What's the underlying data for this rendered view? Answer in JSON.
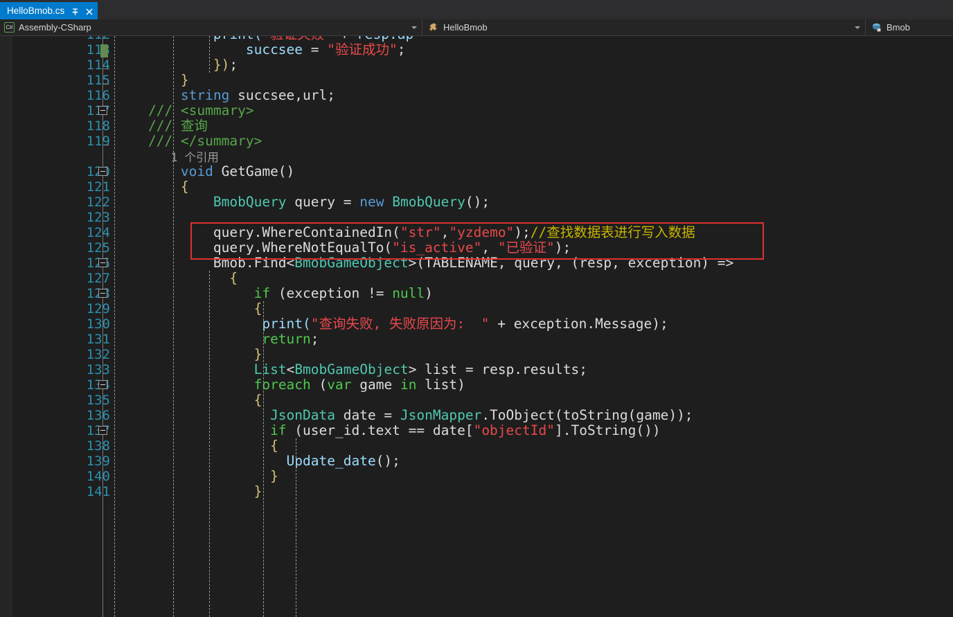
{
  "window": {
    "app": "Visual Studio",
    "theme_bg": "#1e1e1e",
    "accent": "#007acc"
  },
  "tabstrip": {
    "tabs": [
      {
        "title": "HelloBmob.cs",
        "active": true,
        "pin_icon": "pin-icon",
        "close_icon": "close-icon"
      }
    ]
  },
  "navbar": {
    "project": {
      "icon": "csharp-project-icon",
      "icon_text": "C#",
      "label": "Assembly-CSharp",
      "dropdown_icon": "chevron-down-icon"
    },
    "member": {
      "icon": "method-icon",
      "label": "HelloBmob",
      "dropdown_icon": "chevron-down-icon"
    },
    "type": {
      "icon": "class-private-icon",
      "label": "Bmob"
    }
  },
  "editor": {
    "language": "csharp",
    "first_visible_line": 112,
    "last_visible_line": 141,
    "gutter": {
      "line_numbers": [
        113,
        114,
        115,
        116,
        117,
        118,
        119,
        120,
        121,
        122,
        123,
        124,
        125,
        126,
        127,
        128,
        129,
        130,
        131,
        132,
        133,
        134,
        135,
        136,
        137,
        138,
        139,
        140,
        141
      ],
      "change_bar_color": "#608b4e",
      "line_number_color": "#2b91af",
      "collapse_icon": "collapse-minus-icon"
    },
    "annotation": {
      "shape": "rectangle",
      "color": "#e03030",
      "covers_lines": [
        124,
        125
      ]
    },
    "lines": [
      {
        "n": 112,
        "clipped": true,
        "segments": [
          {
            "t": "            ",
            "c": "plain"
          },
          {
            "t": "print(",
            "c": "ident"
          },
          {
            "t": "\"验证失败\"",
            "c": "str"
          },
          {
            "t": " + ",
            "c": "plain"
          },
          {
            "t": "resp.ap",
            "c": "ident"
          }
        ]
      },
      {
        "n": 113,
        "segments": [
          {
            "t": "                ",
            "c": "plain"
          },
          {
            "t": "succsee",
            "c": "ident"
          },
          {
            "t": " = ",
            "c": "plain"
          },
          {
            "t": "\"验证成功\"",
            "c": "str"
          },
          {
            "t": ";",
            "c": "plain"
          }
        ]
      },
      {
        "n": 114,
        "segments": [
          {
            "t": "            ",
            "c": "plain"
          },
          {
            "t": "})",
            "c": "brace"
          },
          {
            "t": ";",
            "c": "plain"
          }
        ]
      },
      {
        "n": 115,
        "segments": [
          {
            "t": "        ",
            "c": "plain"
          },
          {
            "t": "}",
            "c": "brace"
          }
        ]
      },
      {
        "n": 116,
        "segments": [
          {
            "t": "        ",
            "c": "plain"
          },
          {
            "t": "string",
            "c": "kw"
          },
          {
            "t": " succsee,url;",
            "c": "plain"
          }
        ]
      },
      {
        "n": 117,
        "segments": [
          {
            "t": "    ",
            "c": "plain"
          },
          {
            "t": "/// <summary>",
            "c": "cmt"
          }
        ]
      },
      {
        "n": 118,
        "segments": [
          {
            "t": "    ",
            "c": "plain"
          },
          {
            "t": "/// 查询",
            "c": "cmt"
          }
        ]
      },
      {
        "n": 119,
        "segments": [
          {
            "t": "    ",
            "c": "plain"
          },
          {
            "t": "/// </summary>",
            "c": "cmt"
          }
        ]
      },
      {
        "n": null,
        "codelens": true,
        "segments": [
          {
            "t": "        ",
            "c": "plain"
          },
          {
            "t": "1 个引用",
            "c": "codelens"
          }
        ]
      },
      {
        "n": 120,
        "segments": [
          {
            "t": "        ",
            "c": "plain"
          },
          {
            "t": "void",
            "c": "kw"
          },
          {
            "t": " GetGame()",
            "c": "plain"
          }
        ]
      },
      {
        "n": 121,
        "segments": [
          {
            "t": "        ",
            "c": "plain"
          },
          {
            "t": "{",
            "c": "brace"
          }
        ]
      },
      {
        "n": 122,
        "segments": [
          {
            "t": "            ",
            "c": "plain"
          },
          {
            "t": "BmobQuery",
            "c": "type"
          },
          {
            "t": " query = ",
            "c": "plain"
          },
          {
            "t": "new",
            "c": "kw"
          },
          {
            "t": " ",
            "c": "plain"
          },
          {
            "t": "BmobQuery",
            "c": "type"
          },
          {
            "t": "();",
            "c": "plain"
          }
        ]
      },
      {
        "n": 123,
        "segments": []
      },
      {
        "n": 124,
        "segments": [
          {
            "t": "            ",
            "c": "plain"
          },
          {
            "t": "query.WhereContainedIn(",
            "c": "plain"
          },
          {
            "t": "\"str\"",
            "c": "str"
          },
          {
            "t": ",",
            "c": "plain"
          },
          {
            "t": "\"yzdemo\"",
            "c": "str"
          },
          {
            "t": ");",
            "c": "plain"
          },
          {
            "t": "//查找数据表进行写入数据",
            "c": "cmtyel"
          }
        ]
      },
      {
        "n": 125,
        "segments": [
          {
            "t": "            ",
            "c": "plain"
          },
          {
            "t": "query.WhereNotEqualTo(",
            "c": "plain"
          },
          {
            "t": "\"is_active\"",
            "c": "str"
          },
          {
            "t": ", ",
            "c": "plain"
          },
          {
            "t": "\"已验证\"",
            "c": "str"
          },
          {
            "t": ");",
            "c": "plain"
          }
        ]
      },
      {
        "n": 126,
        "segments": [
          {
            "t": "            ",
            "c": "plain"
          },
          {
            "t": "Bmob.Find<",
            "c": "plain"
          },
          {
            "t": "BmobGameObject",
            "c": "type"
          },
          {
            "t": ">(TABLENAME, query, (resp, exception) =>",
            "c": "plain"
          }
        ]
      },
      {
        "n": 127,
        "segments": [
          {
            "t": "              ",
            "c": "plain"
          },
          {
            "t": "{",
            "c": "brace"
          }
        ]
      },
      {
        "n": 128,
        "segments": [
          {
            "t": "                 ",
            "c": "plain"
          },
          {
            "t": "if",
            "c": "kwctl"
          },
          {
            "t": " (exception != ",
            "c": "plain"
          },
          {
            "t": "null",
            "c": "kwctl"
          },
          {
            "t": ")",
            "c": "plain"
          }
        ]
      },
      {
        "n": 129,
        "segments": [
          {
            "t": "                 ",
            "c": "plain"
          },
          {
            "t": "{",
            "c": "brace"
          }
        ]
      },
      {
        "n": 130,
        "segments": [
          {
            "t": "                  ",
            "c": "plain"
          },
          {
            "t": "print(",
            "c": "ident"
          },
          {
            "t": "\"查询失败, 失败原因为:  \"",
            "c": "str"
          },
          {
            "t": " + exception.Message);",
            "c": "plain"
          }
        ]
      },
      {
        "n": 131,
        "segments": [
          {
            "t": "                  ",
            "c": "plain"
          },
          {
            "t": "return",
            "c": "kwctl"
          },
          {
            "t": ";",
            "c": "plain"
          }
        ]
      },
      {
        "n": 132,
        "segments": [
          {
            "t": "                 ",
            "c": "plain"
          },
          {
            "t": "}",
            "c": "brace"
          }
        ]
      },
      {
        "n": 133,
        "segments": [
          {
            "t": "                 ",
            "c": "plain"
          },
          {
            "t": "List",
            "c": "type"
          },
          {
            "t": "<",
            "c": "plain"
          },
          {
            "t": "BmobGameObject",
            "c": "type"
          },
          {
            "t": "> list = resp.results;",
            "c": "plain"
          }
        ]
      },
      {
        "n": 134,
        "segments": [
          {
            "t": "                 ",
            "c": "plain"
          },
          {
            "t": "foreach",
            "c": "kwctl"
          },
          {
            "t": " (",
            "c": "plain"
          },
          {
            "t": "var",
            "c": "kwctl"
          },
          {
            "t": " game ",
            "c": "plain"
          },
          {
            "t": "in",
            "c": "kwctl"
          },
          {
            "t": " list)",
            "c": "plain"
          }
        ]
      },
      {
        "n": 135,
        "segments": [
          {
            "t": "                 ",
            "c": "plain"
          },
          {
            "t": "{",
            "c": "brace"
          }
        ]
      },
      {
        "n": 136,
        "segments": [
          {
            "t": "                   ",
            "c": "plain"
          },
          {
            "t": "JsonData",
            "c": "type"
          },
          {
            "t": " date = ",
            "c": "plain"
          },
          {
            "t": "JsonMapper",
            "c": "type"
          },
          {
            "t": ".ToObject(toString(game));",
            "c": "plain"
          }
        ]
      },
      {
        "n": 137,
        "segments": [
          {
            "t": "                   ",
            "c": "plain"
          },
          {
            "t": "if",
            "c": "kwctl"
          },
          {
            "t": " (user_id.text == date[",
            "c": "plain"
          },
          {
            "t": "\"objectId\"",
            "c": "str"
          },
          {
            "t": "].ToString())",
            "c": "plain"
          }
        ]
      },
      {
        "n": 138,
        "segments": [
          {
            "t": "                   ",
            "c": "plain"
          },
          {
            "t": "{",
            "c": "brace"
          }
        ]
      },
      {
        "n": 139,
        "segments": [
          {
            "t": "                     ",
            "c": "plain"
          },
          {
            "t": "Update_date",
            "c": "ident"
          },
          {
            "t": "();",
            "c": "plain"
          }
        ]
      },
      {
        "n": 140,
        "segments": [
          {
            "t": "                   ",
            "c": "plain"
          },
          {
            "t": "}",
            "c": "brace"
          }
        ]
      },
      {
        "n": 141,
        "clipped": true,
        "segments": [
          {
            "t": "                 ",
            "c": "plain"
          },
          {
            "t": "}",
            "c": "brace"
          }
        ]
      }
    ]
  }
}
